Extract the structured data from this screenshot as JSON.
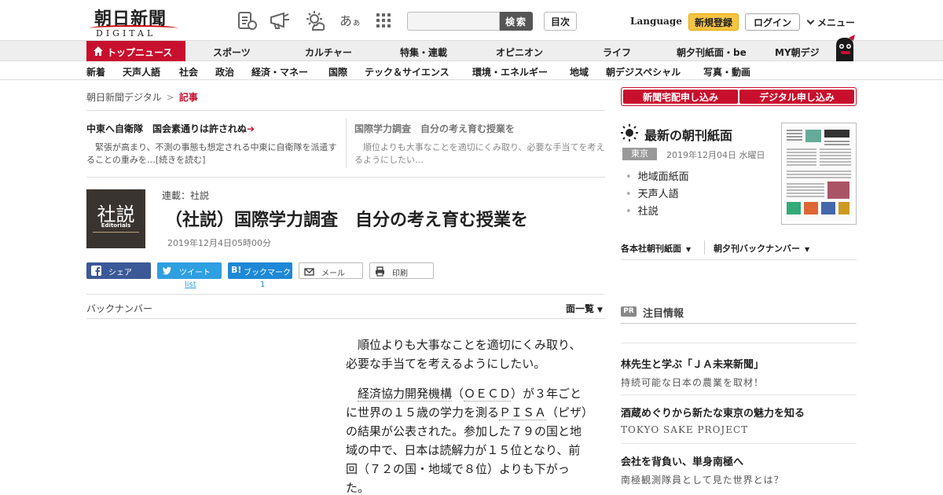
{
  "header": {
    "logo_kanji": "朝日新聞",
    "logo_sub": "DIGITAL",
    "search_placeholder": "",
    "search_label": "検索",
    "toc_label": "目次",
    "language_label": "Language",
    "register_label": "新規登録",
    "login_label": "ログイン",
    "menu_label": "メニュー"
  },
  "category_nav": {
    "top_news": "トップニュース",
    "items": [
      "スポーツ",
      "カルチャー",
      "特集・連載",
      "オピニオン",
      "ライフ",
      "朝夕刊紙面・be",
      "MY朝デジ"
    ]
  },
  "sub_nav": {
    "items": [
      "新着",
      "天声人語",
      "社会",
      "政治",
      "経済・マネー",
      "国際",
      "テック＆サイエンス",
      "環境・エネルギー",
      "地域",
      "朝デジスペシャル",
      "写真・動画"
    ]
  },
  "breadcrumb": {
    "home": "朝日新聞デジタル",
    "separator": ">",
    "current": "記事"
  },
  "related": [
    {
      "title": "中東へ自衛隊　国会素通りは許されぬ",
      "arrow": "➔",
      "body": "緊張が高まり、不測の事態も想定される中東に自衛隊を派遣することの重みを…[続きを読む]"
    },
    {
      "title": "国際学力調査　自分の考え育む授業を",
      "body": "順位よりも大事なことを適切にくみ取り、必要な手当てを考えるようにしたい…"
    }
  ],
  "article": {
    "badge_kanji": "社説",
    "badge_en": "Editorials",
    "series": "連載：社説",
    "title": "（社説）国際学力調査　自分の考え育む授業を",
    "date": "2019年12月4日05時00分",
    "share": {
      "facebook": "シェア",
      "twitter": "ツイート",
      "hatena": "ブックマーク",
      "mail": "メール",
      "print": "印刷",
      "twitter_count": "list",
      "hatena_count": "1"
    },
    "backnumber_label": "バックナンバー",
    "page_list_label": "面一覧",
    "body_p1": "順位よりも大事なことを適切にくみ取り、必要な手当てを考えるようにしたい。",
    "body_p2_a": "経済協力開発機構",
    "body_p2_b": "（",
    "body_p2_c": "ＯＥＣＤ",
    "body_p2_d": "）が３年ごとに世界の１５歳の学力を測る",
    "body_p2_e": "ＰＩＳＡ",
    "body_p2_f": "（ピザ）の結果が公表された。参加した７９の国と地域の中で、日本は読解力が１５位となり、前回（７２の国・地域で８位）よりも下がった。"
  },
  "sidebar": {
    "subscribe_paper": "新聞宅配申し込み",
    "subscribe_digital": "デジタル申し込み",
    "morning_title": "最新の朝刊紙面",
    "edition": "東京",
    "edition_date": "2019年12月04日 水曜日",
    "paper_links": [
      "地域面紙面",
      "天声人語",
      "社説"
    ],
    "paper_select_1": "各本社朝刊紙面",
    "paper_select_2": "朝夕刊バックナンバー",
    "pr_badge": "PR",
    "pr_title": "注目情報",
    "pr_items": [
      {
        "title": "林先生と学ぶ「ＪＡ未来新聞」",
        "sub": "持続可能な日本の農業を取材！"
      },
      {
        "title": "酒蔵めぐりから新たな東京の魅力を知る",
        "sub": "TOKYO SAKE PROJECT"
      },
      {
        "title": "会社を背負い、単身南極へ",
        "sub": "南極観測隊員として見た世界とは？"
      }
    ]
  },
  "colors": {
    "brand_red": "#c8102e",
    "register_yellow": "#f5c443",
    "facebook": "#3b5998",
    "twitter": "#2e9fe0",
    "hatena": "#1e88d6"
  },
  "icons": [
    "papers-icon",
    "megaphone-icon",
    "weather-icon",
    "font-size-icon",
    "apps-grid-icon",
    "home-icon",
    "mascot-icon",
    "sun-icon",
    "facebook-icon",
    "twitter-icon",
    "hatena-icon",
    "mail-icon",
    "print-icon"
  ]
}
